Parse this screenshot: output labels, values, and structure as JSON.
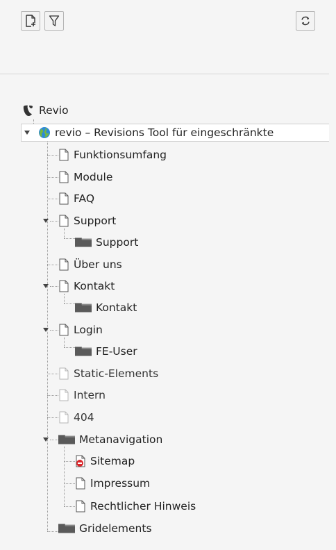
{
  "toolbar": {
    "new_page_icon": "new-page-icon",
    "filter_icon": "filter-icon",
    "refresh_icon": "refresh-icon"
  },
  "tree": {
    "root_label": "Revio",
    "site_label": "revio – Revisions Tool für eingeschränkte",
    "items": [
      {
        "label": "Funktionsumfang",
        "icon": "page-icon"
      },
      {
        "label": "Module",
        "icon": "page-icon"
      },
      {
        "label": "FAQ",
        "icon": "page-icon"
      },
      {
        "label": "Support",
        "icon": "page-icon",
        "expanded": true
      },
      {
        "label": "Support",
        "icon": "folder-icon"
      },
      {
        "label": "Über uns",
        "icon": "page-icon"
      },
      {
        "label": "Kontakt",
        "icon": "page-icon",
        "expanded": true
      },
      {
        "label": "Kontakt",
        "icon": "folder-icon"
      },
      {
        "label": "Login",
        "icon": "page-icon",
        "expanded": true
      },
      {
        "label": "FE-User",
        "icon": "folder-icon"
      },
      {
        "label": "Static-Elements",
        "icon": "page-hidden-icon"
      },
      {
        "label": "Intern",
        "icon": "page-hidden-icon"
      },
      {
        "label": "404",
        "icon": "page-hidden-icon"
      },
      {
        "label": "Metanavigation",
        "icon": "folder-icon",
        "expanded": true
      },
      {
        "label": "Sitemap",
        "icon": "page-restricted-icon"
      },
      {
        "label": "Impressum",
        "icon": "page-icon"
      },
      {
        "label": "Rechtlicher Hinweis",
        "icon": "page-icon"
      },
      {
        "label": "Gridelements",
        "icon": "folder-icon"
      }
    ]
  }
}
